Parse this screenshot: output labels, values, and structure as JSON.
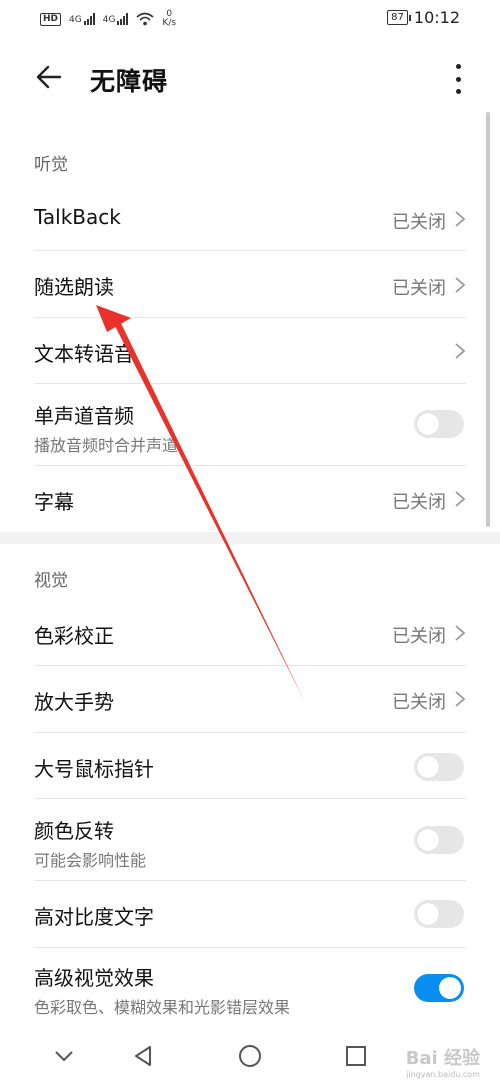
{
  "status": {
    "hd": "HD",
    "net1": "4G",
    "net2": "4G",
    "speed_value": "0",
    "speed_unit": "K/s",
    "battery": "87",
    "time": "10:12"
  },
  "header": {
    "title": "无障碍"
  },
  "sections": {
    "hearing": {
      "label": "听觉",
      "talkback": {
        "label": "TalkBack",
        "value": "已关闭"
      },
      "select_to_speak": {
        "label": "随选朗读",
        "value": "已关闭"
      },
      "tts": {
        "label": "文本转语音"
      },
      "mono": {
        "label": "单声道音频",
        "sub": "播放音频时合并声道",
        "on": false
      },
      "captions": {
        "label": "字幕",
        "value": "已关闭"
      }
    },
    "vision": {
      "label": "视觉",
      "color_correction": {
        "label": "色彩校正",
        "value": "已关闭"
      },
      "magnification": {
        "label": "放大手势",
        "value": "已关闭"
      },
      "large_pointer": {
        "label": "大号鼠标指针",
        "on": false
      },
      "color_inversion": {
        "label": "颜色反转",
        "sub": "可能会影响性能",
        "on": false
      },
      "high_contrast": {
        "label": "高对比度文字",
        "on": false
      },
      "advanced_visual": {
        "label": "高级视觉效果",
        "sub": "色彩取色、模糊效果和光影错层效果",
        "on": true
      }
    }
  },
  "watermark": {
    "brand": "Bai 经验",
    "url": "jingyan.baidu.com"
  },
  "colors": {
    "accent": "#0a8ff0",
    "annotation_arrow": "#e8322b"
  }
}
